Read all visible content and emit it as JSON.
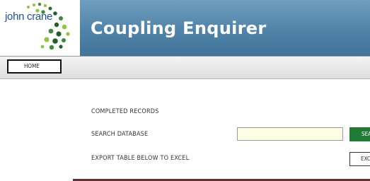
{
  "header": {
    "logo_text": "john crane",
    "app_title": "Coupling Enquirer",
    "background": "#4f83a8"
  },
  "nav": {
    "home_label": "HOME"
  },
  "main": {
    "completed_records_label": "COMPLETED RECORDS",
    "search_label": "SEARCH DATABASE",
    "search_value": "",
    "search_button_label": "SEA",
    "export_label": "EXPORT TABLE BELOW TO EXCEL",
    "export_button_label": "EXC"
  },
  "colors": {
    "search_button": "#1f7a33",
    "search_input_bg": "#fdfde3",
    "table_header": "#6b2d2d"
  }
}
